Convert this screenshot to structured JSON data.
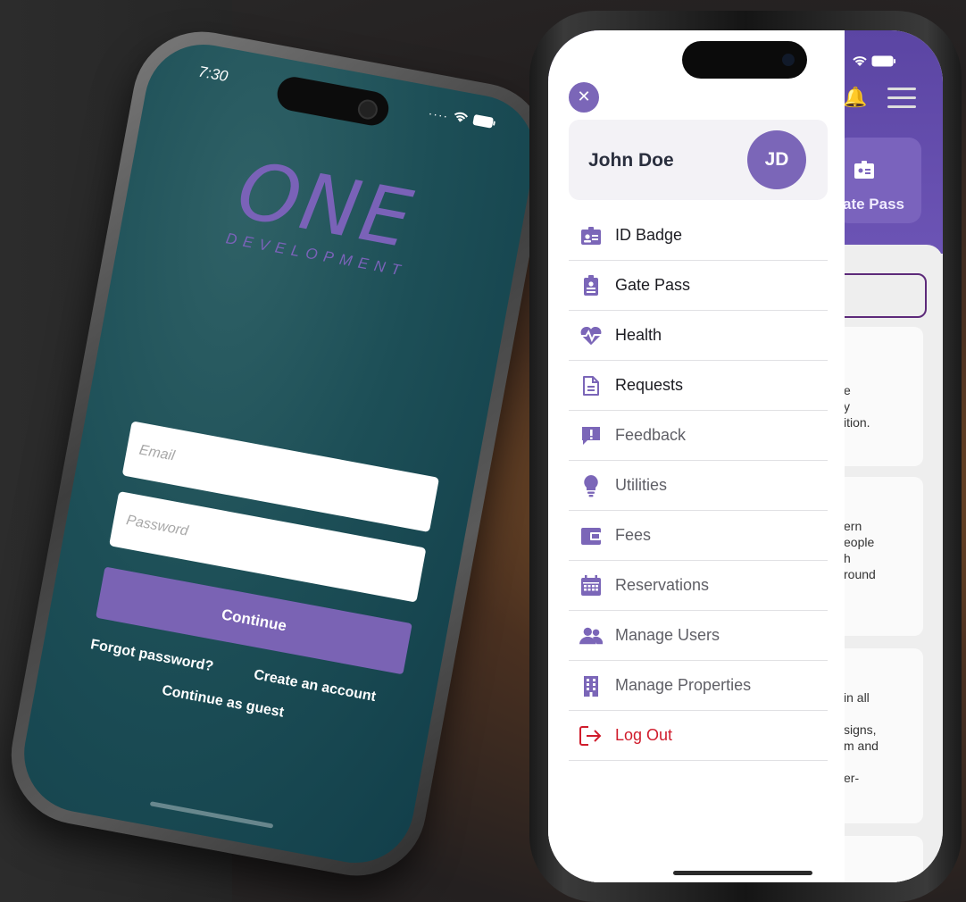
{
  "login_screen": {
    "status_time": "7:30",
    "logo_main": "ONE",
    "logo_sub": "DEVELOPMENT",
    "email_placeholder": "Email",
    "password_placeholder": "Password",
    "continue_label": "Continue",
    "forgot_password": "Forgot password?",
    "create_account": "Create an account",
    "continue_guest": "Continue as guest"
  },
  "drawer": {
    "close_glyph": "✕",
    "user_name": "John Doe",
    "avatar_initials": "JD",
    "items": [
      {
        "label": "ID Badge",
        "icon": "id-badge-icon"
      },
      {
        "label": "Gate Pass",
        "icon": "gate-pass-icon"
      },
      {
        "label": "Health",
        "icon": "heartbeat-icon"
      },
      {
        "label": "Requests",
        "icon": "document-icon"
      },
      {
        "label": "Feedback",
        "icon": "feedback-icon"
      },
      {
        "label": "Utilities",
        "icon": "lightbulb-icon"
      },
      {
        "label": "Fees",
        "icon": "wallet-icon"
      },
      {
        "label": "Reservations",
        "icon": "calendar-icon"
      },
      {
        "label": "Manage Users",
        "icon": "users-icon"
      },
      {
        "label": "Manage Properties",
        "icon": "building-icon"
      },
      {
        "label": "Log Out",
        "icon": "logout-icon"
      }
    ]
  },
  "background_app": {
    "tile_label": "ate Pass",
    "card1": [
      "e",
      "y",
      "ition."
    ],
    "card2": [
      "ern",
      "eople",
      "h",
      "round"
    ],
    "card3": [
      "in all",
      "",
      "signs,",
      "m and",
      "",
      "er-"
    ]
  },
  "colors": {
    "accent": "#7b66b8",
    "danger": "#d01c2c",
    "login_bg": "#1d4f57"
  }
}
